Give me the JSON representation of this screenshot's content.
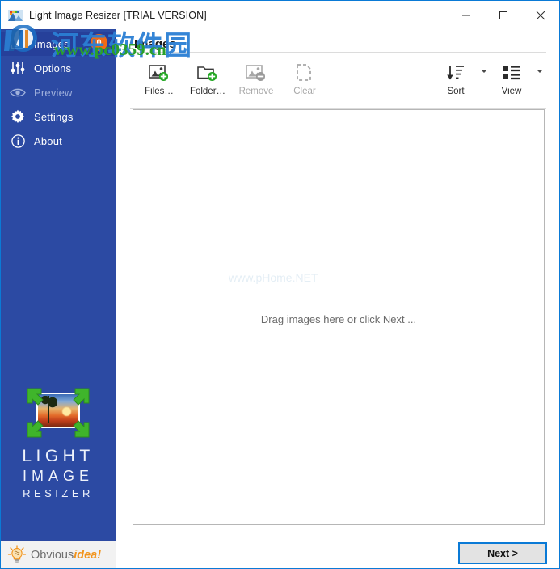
{
  "window": {
    "title": "Light Image Resizer  [TRIAL VERSION]",
    "icon": "app-icon",
    "accent_color": "#0a7ad6",
    "controls": [
      {
        "name": "minimize",
        "glyph": "minimize-icon"
      },
      {
        "name": "maximize",
        "glyph": "maximize-icon"
      },
      {
        "name": "close",
        "glyph": "close-icon"
      }
    ]
  },
  "sidebar": {
    "background_color": "#2c4aa3",
    "selected_color": "#26409a",
    "items": [
      {
        "label": "Images",
        "icon": "images-icon",
        "selected": true,
        "disabled": false,
        "badge": "0"
      },
      {
        "label": "Options",
        "icon": "sliders-icon",
        "selected": false,
        "disabled": false
      },
      {
        "label": "Preview",
        "icon": "eye-icon",
        "selected": false,
        "disabled": true
      },
      {
        "label": "Settings",
        "icon": "gear-icon",
        "selected": false,
        "disabled": false
      },
      {
        "label": "About",
        "icon": "info-icon",
        "selected": false,
        "disabled": false
      }
    ],
    "badge_color": "#f06a15",
    "logo": {
      "icon": "light-image-resizer-logo",
      "line1": "LIGHT",
      "line2": "IMAGE",
      "line3": "RESIZER"
    },
    "footer": {
      "icon": "lightbulb-idea-icon",
      "brand_part1": "Obvious",
      "brand_part2": "idea!",
      "brand_part1_color": "#6f6f6f",
      "brand_part2_color": "#f2941c"
    }
  },
  "main": {
    "page_title": "Images",
    "toolbar": {
      "left": [
        {
          "label": "Files…",
          "icon": "add-image-icon",
          "disabled": false
        },
        {
          "label": "Folder…",
          "icon": "add-folder-icon",
          "disabled": false
        },
        {
          "label": "Remove",
          "icon": "remove-image-icon",
          "disabled": true
        },
        {
          "label": "Clear",
          "icon": "clear-icon",
          "disabled": true
        }
      ],
      "right": [
        {
          "label": "Sort",
          "icon": "sort-icon",
          "has_dropdown": true
        },
        {
          "label": "View",
          "icon": "view-icon",
          "has_dropdown": true
        }
      ]
    },
    "droparea": {
      "message": "Drag images here or click Next ..."
    }
  },
  "footer": {
    "next_label": "Next >"
  },
  "watermarks": {
    "chinese": "河东软件园",
    "url": "www.pc0359.cn",
    "faint": "www.pHome.NET"
  }
}
